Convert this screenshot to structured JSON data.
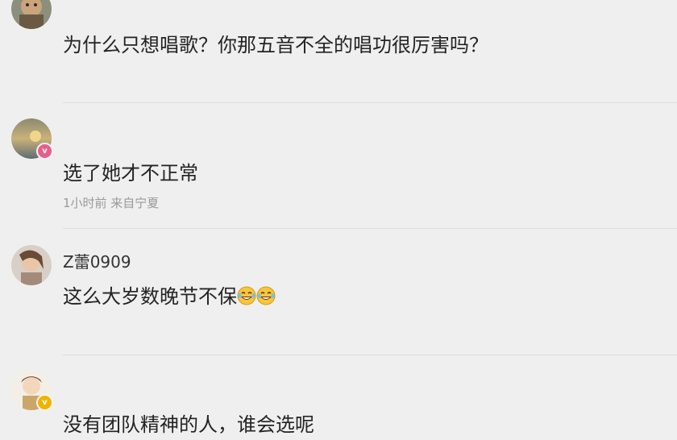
{
  "comments": [
    {
      "username": "",
      "text": "为什么只想唱歌？你那五音不全的唱功很厉害吗？",
      "meta": "",
      "badge": null
    },
    {
      "username": "",
      "text": "选了她才不正常",
      "meta": "1小时前 来自宁夏",
      "badge": "v",
      "badge_color": "#e85d8a"
    },
    {
      "username": "Z蕾0909",
      "text": "这么大岁数晚节不保",
      "meta": "",
      "badge": null,
      "emojis": [
        "laughing-tears",
        "laughing-tears"
      ]
    },
    {
      "username": "",
      "text": "没有团队精神的人，谁会选呢",
      "meta": "",
      "badge": "v",
      "badge_color": "#f0b400"
    }
  ],
  "colors": {
    "background": "#efefef",
    "text": "#232323",
    "meta": "#9a9a9a",
    "divider": "#dcdcdc"
  }
}
